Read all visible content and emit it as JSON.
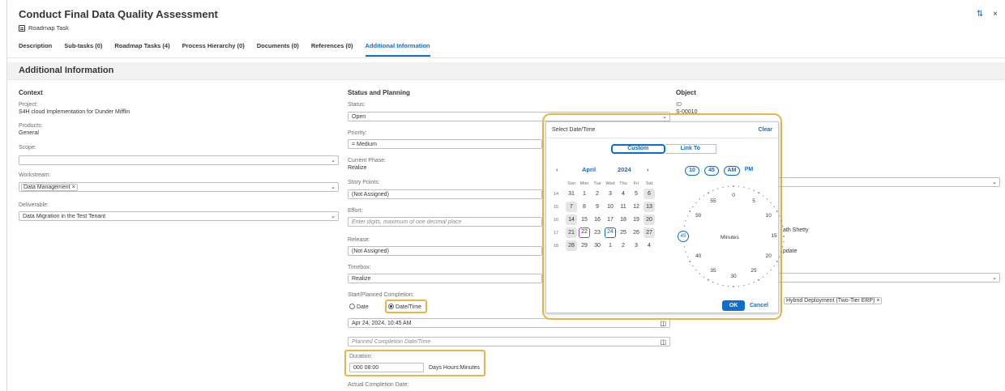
{
  "header": {
    "title": "Conduct Final Data Quality Assessment",
    "subtitle": "Roadmap Task",
    "icons": [
      "refresh-icon",
      "close-icon"
    ],
    "refresh_glyph": "⇅",
    "close_glyph": "×"
  },
  "tabs": [
    {
      "label": "Description"
    },
    {
      "label": "Sub-tasks (0)"
    },
    {
      "label": "Roadmap Tasks (4)"
    },
    {
      "label": "Process Hierarchy (0)"
    },
    {
      "label": "Documents (0)"
    },
    {
      "label": "References (0)"
    },
    {
      "label": "Additional Information",
      "active": true
    }
  ],
  "section": {
    "title": "Additional Information"
  },
  "context": {
    "title": "Context",
    "project_label": "Project:",
    "project_value": "S4H cloud Implementation for Dunder Mifflin",
    "products_label": "Products:",
    "products_value": "General",
    "scope_label": "Scope:",
    "workstream_label": "Workstream:",
    "workstream_token": "Data Management ×",
    "deliverable_label": "Deliverable:",
    "deliverable_value": "Data Migration in the Test Tenant"
  },
  "status": {
    "title": "Status and Planning",
    "status_label": "Status:",
    "status_value": "Open",
    "priority_label": "Priority:",
    "priority_value": "= Medium",
    "phase_label": "Current Phase:",
    "phase_value": "Realize",
    "story_label": "Story Points:",
    "story_value": "(Not Assigned)",
    "effort_label": "Effort:",
    "effort_placeholder": "Enter digits, maximum of one decimal place",
    "release_label": "Release:",
    "release_value": "(Not Assigned)",
    "timebox_label": "Timebox:",
    "timebox_value": "Realize",
    "start_label": "Start/Planned Completion:",
    "radio_date": "Date",
    "radio_datetime": "Date/Time",
    "start_value": "Apr 24, 2024, 10:45 AM",
    "planned_placeholder": "Planned Completion Date/Time",
    "duration_label": "Duration:",
    "duration_value": "000 08:00",
    "duration_unit": "Days Hours:Minutes",
    "actual_label": "Actual Completion Date:"
  },
  "object": {
    "title": "Object",
    "id_label": "ID",
    "id_value": "S-00010",
    "person_fragment": "ath Shetty",
    "update_fragment": "pdate",
    "deployment_token": "Hybrid Deployment (Two-Tier ERP) ×"
  },
  "popup": {
    "title": "Select Date/Time",
    "clear": "Clear",
    "seg_custom": "Custom",
    "seg_link": "Link To",
    "month": "April",
    "year": "2024",
    "prev": "‹",
    "next": "›",
    "dow": [
      "Sun",
      "Mon",
      "Tue",
      "Wed",
      "Thu",
      "Fri",
      "Sat"
    ],
    "weeks": [
      {
        "wk": "14",
        "days": [
          "31",
          "1",
          "2",
          "3",
          "4",
          "5",
          "6"
        ]
      },
      {
        "wk": "15",
        "days": [
          "7",
          "8",
          "9",
          "10",
          "11",
          "12",
          "13"
        ]
      },
      {
        "wk": "16",
        "days": [
          "14",
          "15",
          "16",
          "17",
          "18",
          "19",
          "20"
        ]
      },
      {
        "wk": "17",
        "days": [
          "21",
          "22",
          "23",
          "24",
          "25",
          "26",
          "27"
        ]
      },
      {
        "wk": "18",
        "days": [
          "28",
          "29",
          "30",
          "1",
          "2",
          "3",
          "4"
        ]
      }
    ],
    "today_day": "22",
    "selected_day": "24",
    "hour": "10",
    "colon": ":",
    "minute": "45",
    "am": "AM",
    "pm": "PM",
    "clock_numbers": [
      "0",
      "5",
      "10",
      "15",
      "20",
      "25",
      "30",
      "35",
      "40",
      "45",
      "50",
      "55"
    ],
    "clock_center": "Minutes",
    "ok": "OK",
    "cancel": "Cancel"
  },
  "colors": {
    "accent": "#0a6ed1",
    "highlight": "#e9b546",
    "today": "#b23fbf"
  }
}
